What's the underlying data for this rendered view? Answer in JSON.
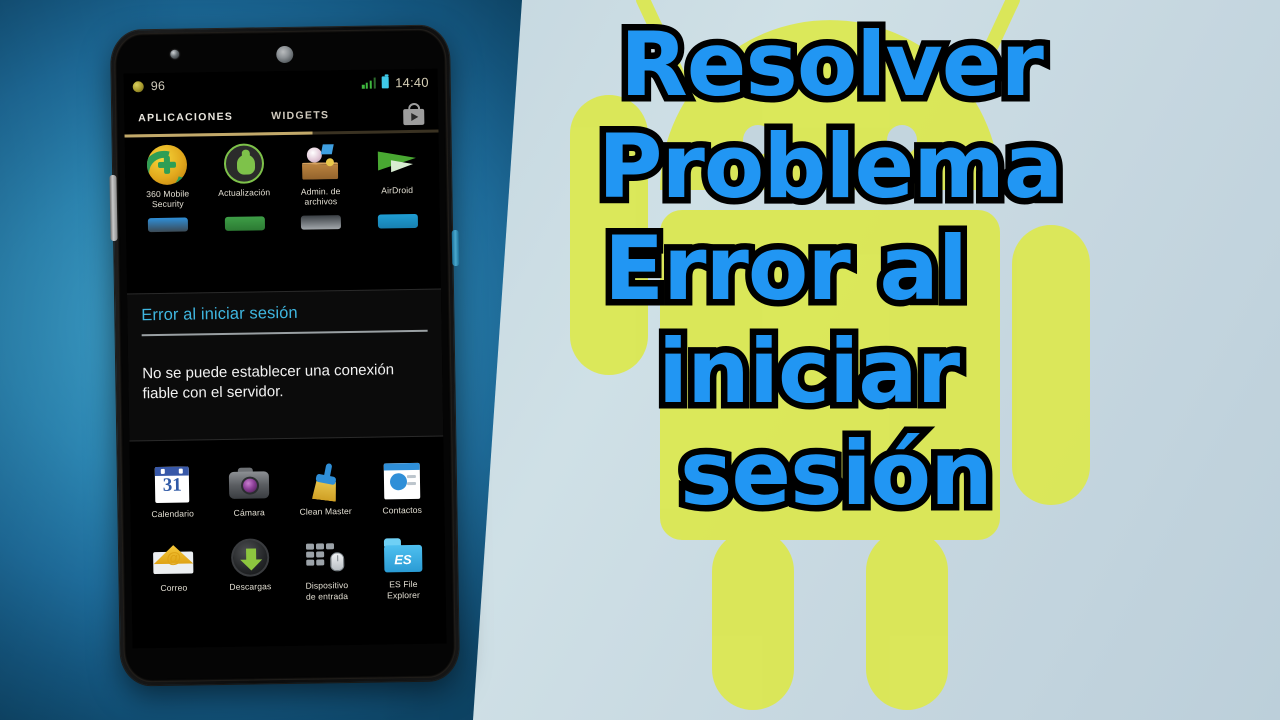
{
  "overlay_title": {
    "lines": [
      "Resolver",
      "Problema",
      "Error  al",
      "iniciar",
      "sesión"
    ],
    "fill_color": "#2196f3",
    "stroke_color": "#000000"
  },
  "background": {
    "left_panel_color": "#2e8bb9",
    "right_panel_color": "#c6d8e0",
    "android_mascot_color": "#dbe84f"
  },
  "phone": {
    "status_bar": {
      "notification_count": "96",
      "time": "14:40",
      "icons": [
        "app-notification-icon",
        "wifi-icon",
        "signal-icon",
        "battery-icon"
      ]
    },
    "tabs": {
      "active": "APLICACIONES",
      "inactive": "WIDGETS",
      "store_icon": "play-store-bag-icon"
    },
    "apps_row1": [
      {
        "label": "360 Mobile\nSecurity",
        "label_l1": "360 Mobile",
        "label_l2": "Security",
        "icon": "shield-plus-icon"
      },
      {
        "label": "Actualización",
        "label_l1": "Actualización",
        "label_l2": "",
        "icon": "android-update-icon"
      },
      {
        "label": "Admin. de\narchivos",
        "label_l1": "Admin. de",
        "label_l2": "archivos",
        "icon": "file-manager-icon"
      },
      {
        "label": "AirDroid",
        "label_l1": "AirDroid",
        "label_l2": "",
        "icon": "paper-plane-icon"
      }
    ],
    "apps_row_partial": [
      {
        "icon": "blue-app-icon"
      },
      {
        "icon": "green-app-icon"
      },
      {
        "icon": "dark-app-icon"
      },
      {
        "icon": "cyan-app-icon"
      }
    ],
    "apps_row2": [
      {
        "label_l1": "Calendario",
        "label_l2": "",
        "icon": "calendar-icon",
        "day": "31"
      },
      {
        "label_l1": "Cámara",
        "label_l2": "",
        "icon": "camera-icon"
      },
      {
        "label_l1": "Clean Master",
        "label_l2": "",
        "icon": "broom-icon"
      },
      {
        "label_l1": "Contactos",
        "label_l2": "",
        "icon": "contacts-icon"
      }
    ],
    "apps_row3": [
      {
        "label_l1": "Correo",
        "label_l2": "",
        "icon": "mail-icon"
      },
      {
        "label_l1": "Descargas",
        "label_l2": "",
        "icon": "download-icon"
      },
      {
        "label_l1": "Dispositivo",
        "label_l2": "de entrada",
        "icon": "input-device-icon"
      },
      {
        "label_l1": "ES File",
        "label_l2": "Explorer",
        "icon": "es-file-explorer-icon",
        "glyph": "ES"
      }
    ],
    "error_dialog": {
      "title": "Error al iniciar sesión",
      "message": "No se puede establecer una conexión fiable con el servidor.",
      "title_color": "#3fb6e0"
    }
  }
}
